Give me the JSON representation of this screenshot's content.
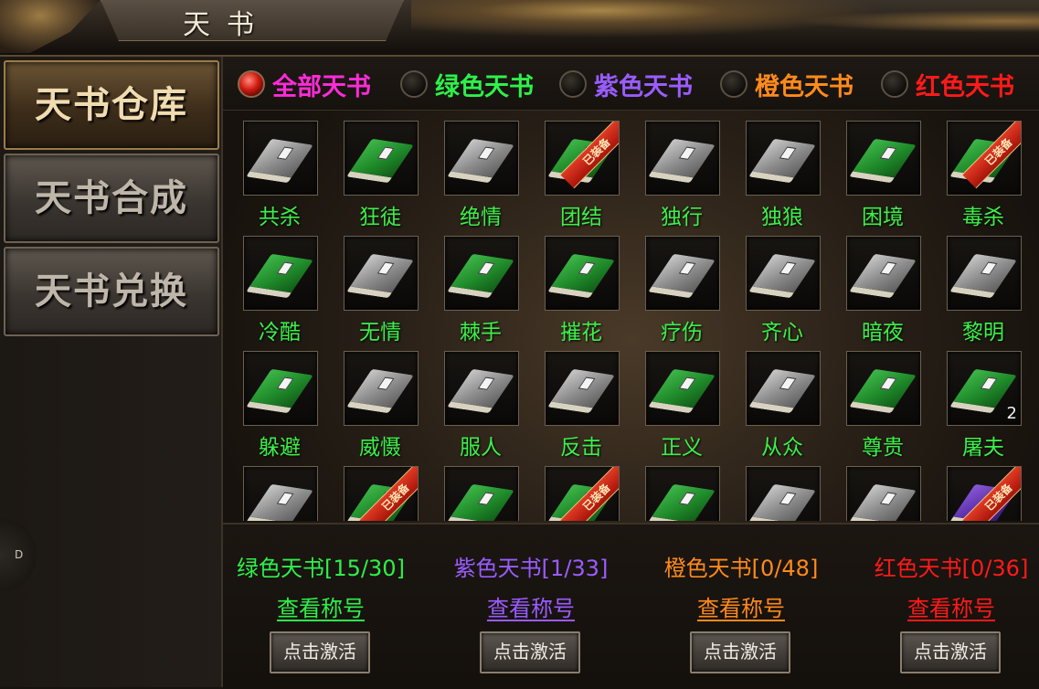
{
  "window": {
    "title": "天书"
  },
  "sidebar": {
    "items": [
      {
        "label": "天书仓库",
        "active": true
      },
      {
        "label": "天书合成",
        "active": false
      },
      {
        "label": "天书兑换",
        "active": false
      }
    ],
    "side_badge": "D"
  },
  "filters": [
    {
      "label": "全部天书",
      "color": "#ff2bd8",
      "selected": true
    },
    {
      "label": "绿色天书",
      "color": "#2ef04a",
      "selected": false
    },
    {
      "label": "紫色天书",
      "color": "#9a5cff",
      "selected": false
    },
    {
      "label": "橙色天书",
      "color": "#ff8a1c",
      "selected": false
    },
    {
      "label": "红色天书",
      "color": "#ff1a1a",
      "selected": false
    }
  ],
  "books": [
    {
      "name": "共杀",
      "color": "grey"
    },
    {
      "name": "狂徒",
      "color": "green"
    },
    {
      "name": "绝情",
      "color": "grey"
    },
    {
      "name": "团结",
      "color": "green",
      "ribbon": "已装备"
    },
    {
      "name": "独行",
      "color": "grey"
    },
    {
      "name": "独狼",
      "color": "grey"
    },
    {
      "name": "困境",
      "color": "green"
    },
    {
      "name": "毒杀",
      "color": "green",
      "ribbon": "已装备"
    },
    {
      "name": "冷酷",
      "color": "green"
    },
    {
      "name": "无情",
      "color": "grey"
    },
    {
      "name": "棘手",
      "color": "green"
    },
    {
      "name": "摧花",
      "color": "green"
    },
    {
      "name": "疗伤",
      "color": "grey"
    },
    {
      "name": "齐心",
      "color": "grey"
    },
    {
      "name": "暗夜",
      "color": "grey"
    },
    {
      "name": "黎明",
      "color": "grey"
    },
    {
      "name": "躲避",
      "color": "green"
    },
    {
      "name": "威慑",
      "color": "grey"
    },
    {
      "name": "服人",
      "color": "grey"
    },
    {
      "name": "反击",
      "color": "grey"
    },
    {
      "name": "正义",
      "color": "green"
    },
    {
      "name": "从众",
      "color": "grey"
    },
    {
      "name": "尊贵",
      "color": "green"
    },
    {
      "name": "屠夫",
      "color": "green",
      "count": "2"
    },
    {
      "name": "",
      "color": "grey"
    },
    {
      "name": "",
      "color": "green",
      "ribbon": "已装备"
    },
    {
      "name": "",
      "color": "green"
    },
    {
      "name": "",
      "color": "green",
      "ribbon": "已装备"
    },
    {
      "name": "",
      "color": "green"
    },
    {
      "name": "",
      "color": "grey"
    },
    {
      "name": "",
      "color": "grey"
    },
    {
      "name": "",
      "color": "purple",
      "ribbon": "已装备"
    }
  ],
  "summary": [
    {
      "title": "绿色天书[15/30]",
      "link": "查看称号",
      "button": "点击激活",
      "color": "#2ef04a"
    },
    {
      "title": "紫色天书[1/33]",
      "link": "查看称号",
      "button": "点击激活",
      "color": "#9a5cff"
    },
    {
      "title": "橙色天书[0/48]",
      "link": "查看称号",
      "button": "点击激活",
      "color": "#ff8a1c"
    },
    {
      "title": "红色天书[0/36]",
      "link": "查看称号",
      "button": "点击激活",
      "color": "#ff1a1a"
    }
  ]
}
